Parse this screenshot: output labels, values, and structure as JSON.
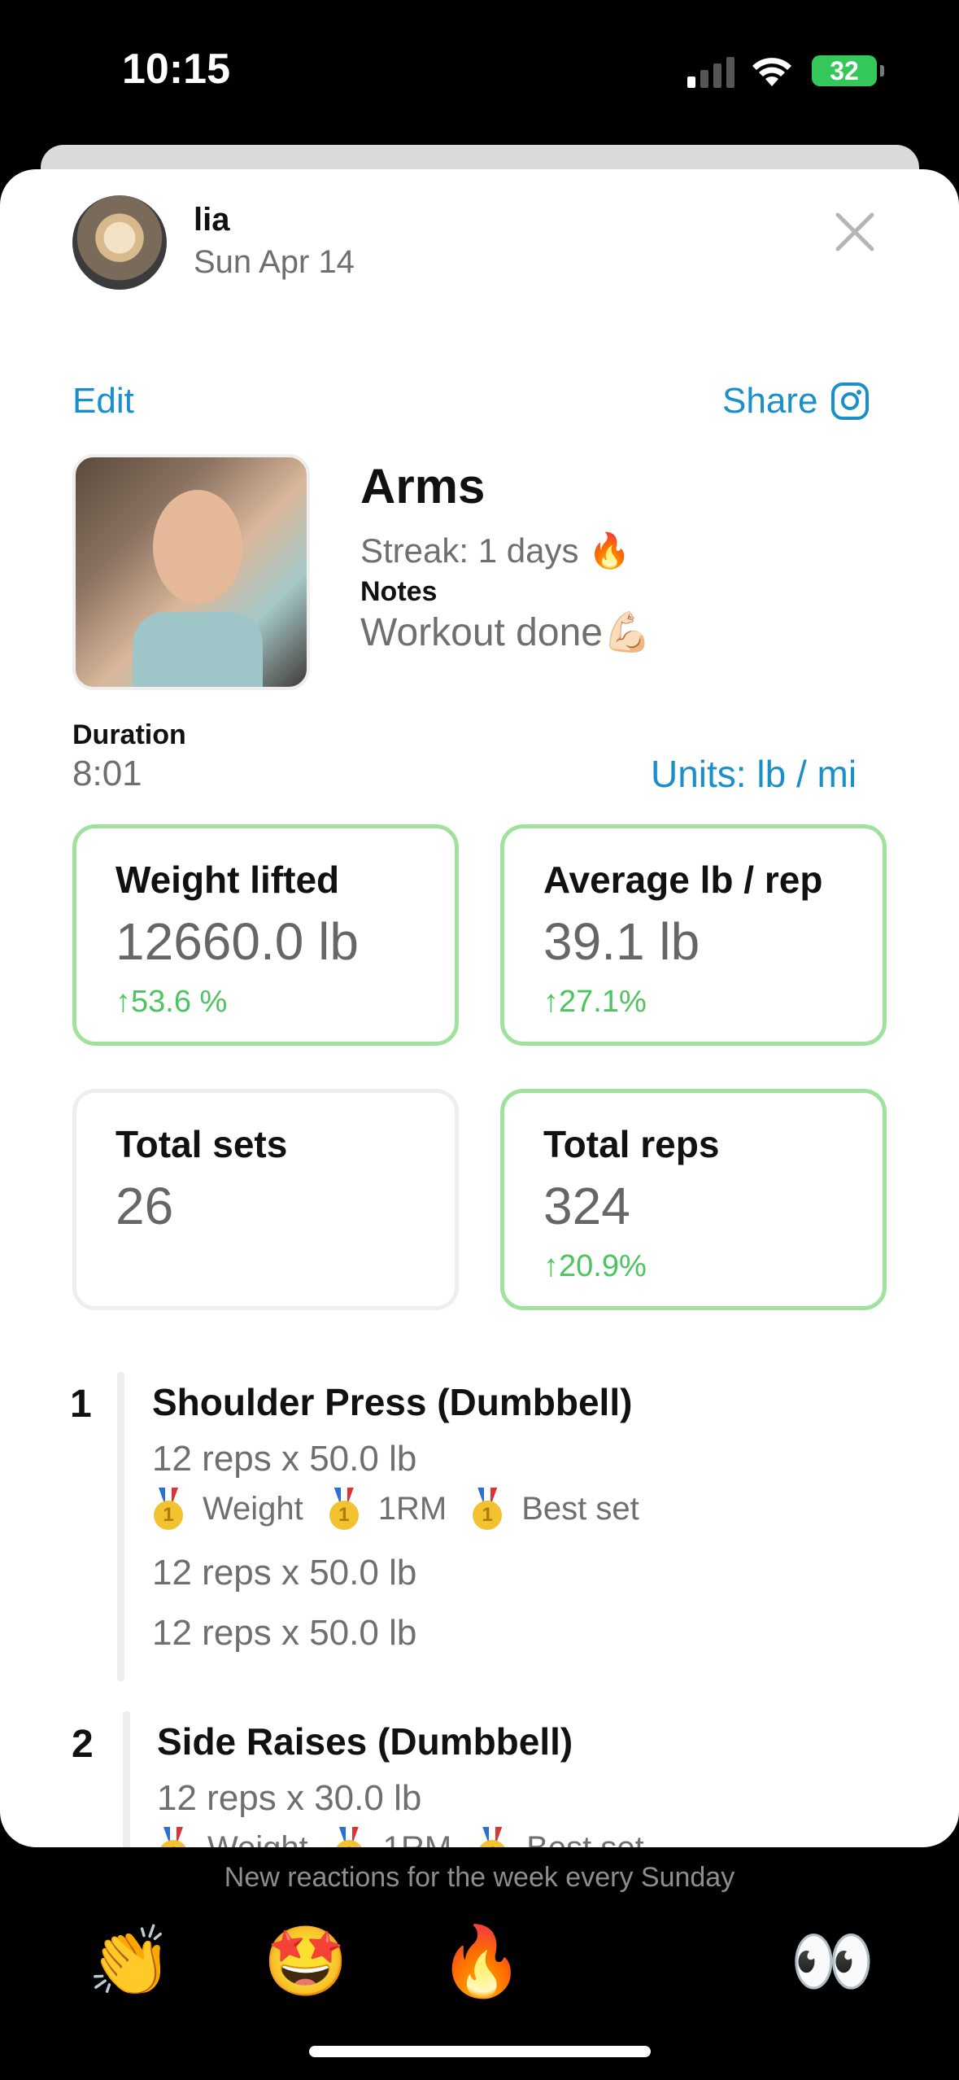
{
  "status_bar": {
    "time": "10:15",
    "battery": "32"
  },
  "header": {
    "user_name": "lia",
    "date": "Sun Apr 14"
  },
  "actions": {
    "edit": "Edit",
    "share": "Share"
  },
  "workout": {
    "title": "Arms",
    "streak": "Streak: 1 days 🔥",
    "notes_label": "Notes",
    "notes": "Workout done💪🏻",
    "duration_label": "Duration",
    "duration": "8:01",
    "units": "Units: lb / mi"
  },
  "stats": [
    {
      "label": "Weight lifted",
      "value": "12660.0 lb",
      "delta": "↑53.6 %"
    },
    {
      "label": "Average lb / rep",
      "value": "39.1 lb",
      "delta": "↑27.1%"
    },
    {
      "label": "Total sets",
      "value": "26",
      "delta": ""
    },
    {
      "label": "Total reps",
      "value": "324",
      "delta": "↑20.9%"
    }
  ],
  "exercises": [
    {
      "number": "1",
      "name": "Shoulder Press (Dumbbell)",
      "sets": [
        "12 reps x 50.0 lb",
        "12 reps x 50.0 lb",
        "12 reps x 50.0 lb"
      ],
      "medals": [
        "Weight",
        "1RM",
        "Best set"
      ]
    },
    {
      "number": "2",
      "name": "Side Raises (Dumbbell)",
      "sets": [
        "12 reps x 30.0 lb"
      ],
      "medals": [
        "Weight",
        "1RM",
        "Best set"
      ]
    }
  ],
  "reactions": {
    "caption": "New reactions for the week every Sunday",
    "items": [
      "👏",
      "🤩",
      "🔥",
      "😶",
      "👀"
    ]
  },
  "colors": {
    "accent": "#1a8fc9",
    "positive": "#4cc45f",
    "card_border": "#9fe29c"
  }
}
